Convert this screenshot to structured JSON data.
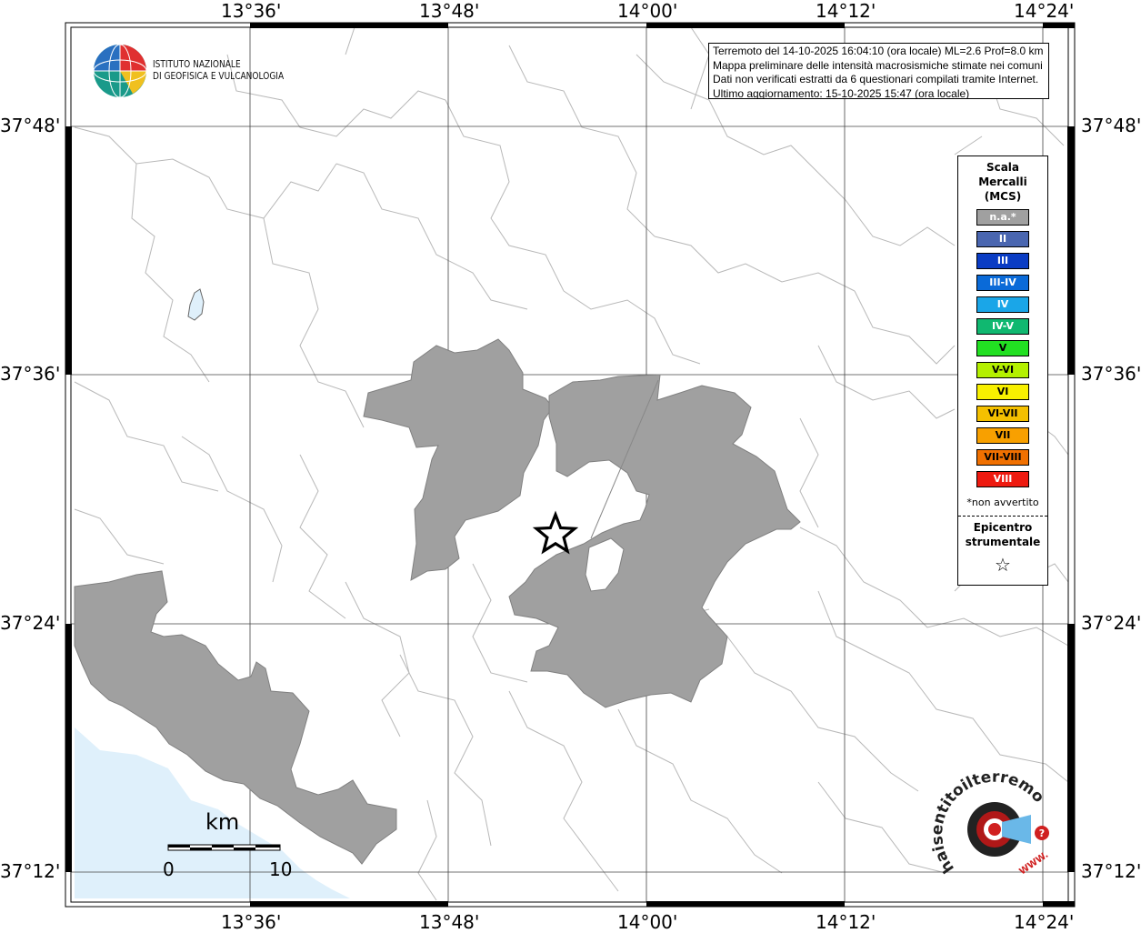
{
  "title_box": {
    "lines": [
      "Terremoto del 14-10-2025 16:04:10 (ora locale) ML=2.6 Prof=8.0 km",
      "Mappa preliminare delle intensità macrosismiche stimate nei comuni",
      "Dati non verificati estratti da 6 questionari compilati tramite Internet.",
      "Ultimo aggiornamento: 15-10-2025 15:47 (ora locale)"
    ]
  },
  "logo": {
    "lines": [
      "ISTITUTO NAZIONALE",
      "DI GEOFISICA E VULCANOLOGIA"
    ]
  },
  "axes": {
    "top_labels": [
      "13°36'",
      "13°48'",
      "14°00'",
      "14°12'",
      "14°24'"
    ],
    "bottom_labels": [
      "13°36'",
      "13°48'",
      "14°00'",
      "14°12'",
      "14°24'"
    ],
    "left_labels": [
      "37°48'",
      "37°36'",
      "37°24'",
      "37°12'"
    ],
    "right_labels": [
      "37°48'",
      "37°36'",
      "37°24'",
      "37°12'"
    ]
  },
  "legend": {
    "title_lines": [
      "Scala",
      "Mercalli",
      "(MCS)"
    ],
    "items": [
      {
        "label": "n.a.*",
        "color": "#a0a0a0"
      },
      {
        "label": "II",
        "color": "#4a66b0"
      },
      {
        "label": "III",
        "color": "#0a3cc4"
      },
      {
        "label": "III-IV",
        "color": "#0a6ad8"
      },
      {
        "label": "IV",
        "color": "#1aa6e8"
      },
      {
        "label": "IV-V",
        "color": "#10b870"
      },
      {
        "label": "V",
        "color": "#22e022"
      },
      {
        "label": "V-VI",
        "color": "#b4f000"
      },
      {
        "label": "VI",
        "color": "#f8f000"
      },
      {
        "label": "VI-VII",
        "color": "#f4c000"
      },
      {
        "label": "VII",
        "color": "#f8a000"
      },
      {
        "label": "VII-VIII",
        "color": "#f07000"
      },
      {
        "label": "VIII",
        "color": "#ee1a10"
      }
    ],
    "note": "*non avvertito",
    "epicenter_lines": [
      "Epicentro",
      "strumentale"
    ],
    "epicenter_symbol": "☆"
  },
  "scale_bar": {
    "unit": "km",
    "start_label": "0",
    "end_label": "10"
  },
  "colors": {
    "not_felt_area": "#a0a0a0",
    "sea": "#dff0fb"
  },
  "watermark": {
    "text": "haisentitoilterremoto.it?",
    "url_text": "WWW."
  }
}
